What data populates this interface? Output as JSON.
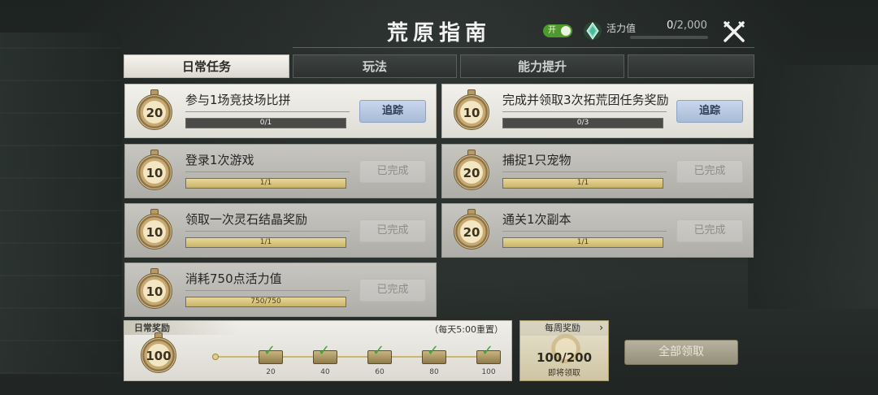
{
  "header": {
    "title": "荒原指南",
    "toggle_label": "开",
    "energy_label": "活力值",
    "energy_current": "0",
    "energy_max": "/2,000",
    "energy_fraction": 0
  },
  "tabs": [
    {
      "label": "日常任务",
      "active": true
    },
    {
      "label": "玩法",
      "active": false
    },
    {
      "label": "能力提升",
      "active": false
    },
    {
      "label": "",
      "active": false
    }
  ],
  "tasks": [
    {
      "points": "20",
      "name": "参与1场竞技场比拼",
      "progress": "0/1",
      "fraction": 0,
      "button": "追踪",
      "done": false
    },
    {
      "points": "10",
      "name": "完成并领取3次拓荒团任务奖励",
      "progress": "0/3",
      "fraction": 0,
      "button": "追踪",
      "done": false
    },
    {
      "points": "10",
      "name": "登录1次游戏",
      "progress": "1/1",
      "fraction": 1,
      "button": "已完成",
      "done": true
    },
    {
      "points": "20",
      "name": "捕捉1只宠物",
      "progress": "1/1",
      "fraction": 1,
      "button": "已完成",
      "done": true
    },
    {
      "points": "10",
      "name": "领取一次灵石结晶奖励",
      "progress": "1/1",
      "fraction": 1,
      "button": "已完成",
      "done": true
    },
    {
      "points": "20",
      "name": "通关1次副本",
      "progress": "1/1",
      "fraction": 1,
      "button": "已完成",
      "done": true
    },
    {
      "points": "10",
      "name": "消耗750点活力值",
      "progress": "750/750",
      "fraction": 1,
      "button": "已完成",
      "done": true
    }
  ],
  "daily_reward": {
    "title": "日常奖励",
    "reset_note": "（每天5:00重置）",
    "current": "100",
    "milestones": [
      "20",
      "40",
      "60",
      "80",
      "100"
    ]
  },
  "weekly_reward": {
    "title": "每周奖励",
    "arrow": "›",
    "value": "100/200",
    "status": "即将领取"
  },
  "claim_all_label": "全部领取",
  "colors": {
    "track_button": "#b4c5df",
    "complete_bar": "#d4c27c",
    "toggle_on": "#4f9a2c"
  }
}
